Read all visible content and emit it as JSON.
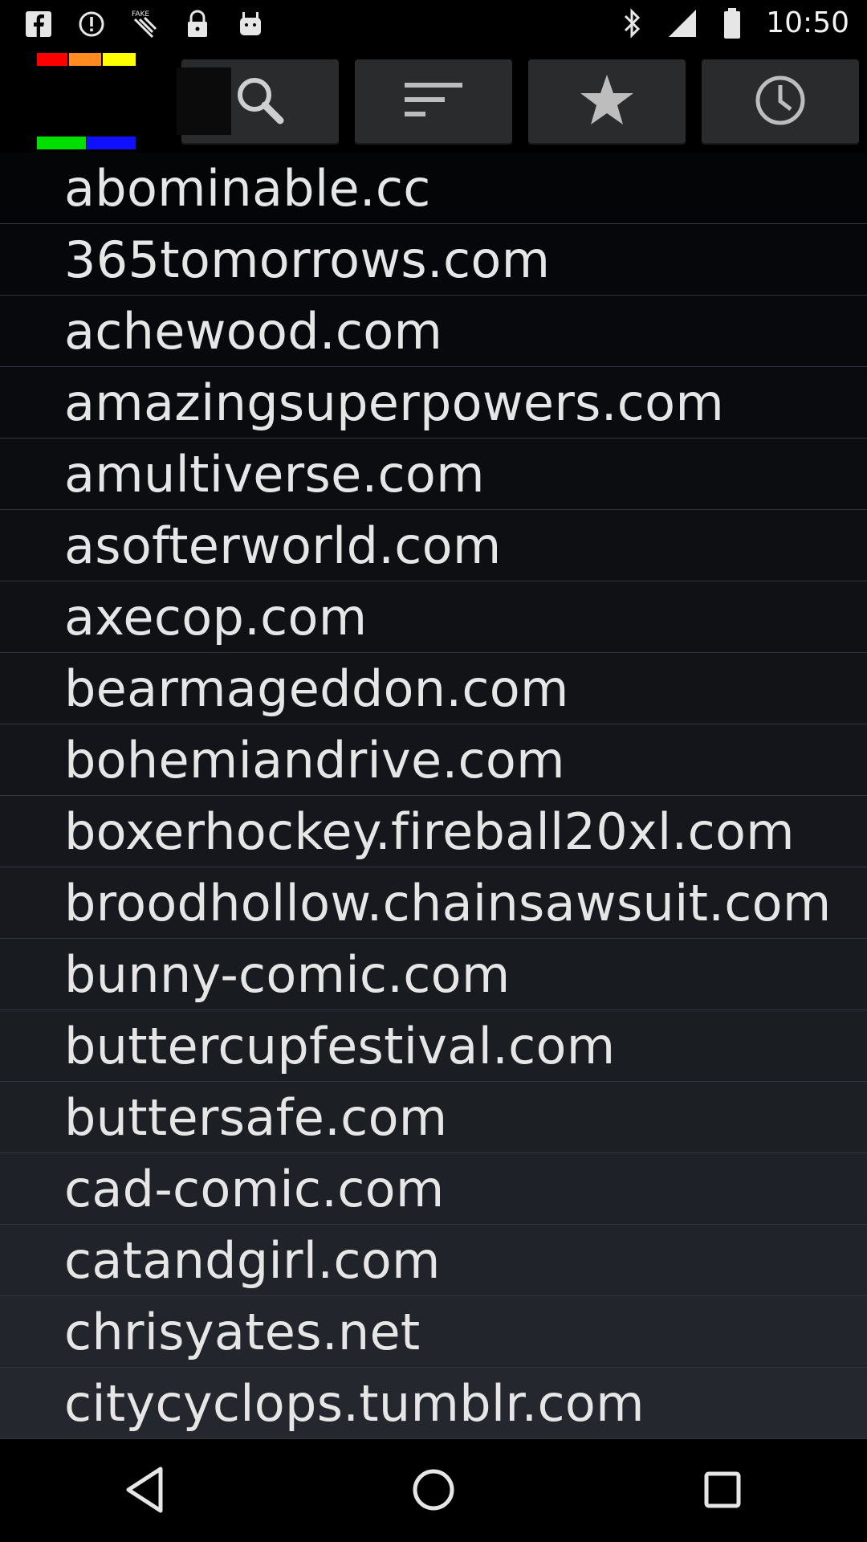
{
  "status_bar": {
    "time": "10:50",
    "icons": [
      "facebook-icon",
      "alert-icon",
      "flask-icon",
      "lock-icon",
      "android-icon",
      "bluetooth-icon",
      "signal-icon",
      "battery-icon"
    ]
  },
  "header": {
    "logo_colors": [
      "#ff0000",
      "#ff8a1f",
      "#ffff00",
      "#00e000",
      "#1010ff"
    ],
    "tabs": [
      {
        "name": "search",
        "icon": "search-icon"
      },
      {
        "name": "sort",
        "icon": "sort-icon"
      },
      {
        "name": "favorites",
        "icon": "star-icon"
      },
      {
        "name": "recent",
        "icon": "clock-icon"
      }
    ]
  },
  "list": {
    "items": [
      "abominable.cc",
      "365tomorrows.com",
      "achewood.com",
      "amazingsuperpowers.com",
      "amultiverse.com",
      "asofterworld.com",
      "axecop.com",
      "bearmageddon.com",
      "bohemiandrive.com",
      "boxerhockey.fireball20xl.com",
      "broodhollow.chainsawsuit.com",
      "bunny-comic.com",
      "buttercupfestival.com",
      "buttersafe.com",
      "cad-comic.com",
      "catandgirl.com",
      "chrisyates.net",
      "citycyclops.tumblr.com"
    ]
  },
  "navbar": {
    "buttons": [
      "back-icon",
      "home-icon",
      "recents-icon"
    ]
  }
}
